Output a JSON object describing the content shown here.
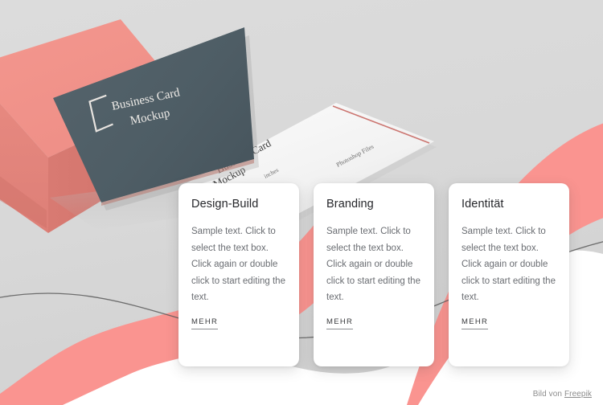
{
  "page": {
    "background_color": "#d8d8d8",
    "accent_color": "#fa9490",
    "dark_card_color": "#4f5e67"
  },
  "hero": {
    "dark_card": {
      "line1": "Business Card",
      "line2": "Mockup",
      "logo_icon": "square-bracket-logo-icon"
    },
    "light_card": {
      "line1": "Business Card",
      "line2": "Mockup",
      "line3": "inches",
      "line4": "Photoshop Files"
    },
    "box_shape": "coral-cube"
  },
  "cards": [
    {
      "title": "Design-Build",
      "body": "Sample text. Click to select the text box. Click again or double click to start editing the text.",
      "link_label": "MEHR"
    },
    {
      "title": "Branding",
      "body": "Sample text. Click to select the text box. Click again or double click to start editing the text.",
      "link_label": "MEHR"
    },
    {
      "title": "Identität",
      "body": "Sample text. Click to select the text box. Click again or double click to start editing the text.",
      "link_label": "MEHR"
    }
  ],
  "footer": {
    "credit_prefix": "Bild von ",
    "credit_link": "Freepik"
  }
}
